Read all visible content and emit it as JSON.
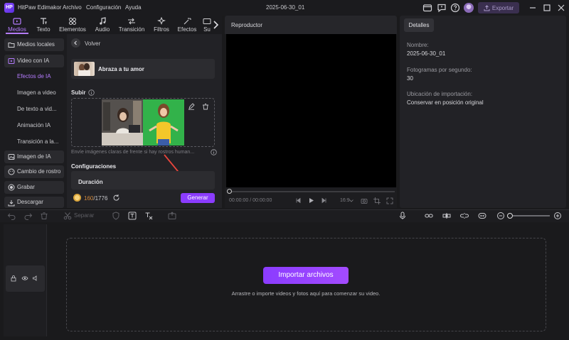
{
  "app": {
    "name": "HitPaw Edimakor",
    "logo_text": "HP",
    "project": "2025-06-30_01"
  },
  "menu": [
    "Archivo",
    "Configuración",
    "Ayuda"
  ],
  "titlebar": {
    "export_label": "Exportar"
  },
  "tool_tabs": [
    "Medios",
    "Texto",
    "Elementos",
    "Audio",
    "Transición",
    "Filtros",
    "Efectos",
    "Su"
  ],
  "nav": {
    "local_media": "Medios locales",
    "ai_video": "Video con IA",
    "sub": [
      "Efectos de IA",
      "Imagen a video",
      "De texto a vid...",
      "Animación IA",
      "Transición a la..."
    ],
    "ai_image": "Imagen de IA",
    "face_swap": "Cambio de rostro",
    "record": "Grabar",
    "download": "Descargar"
  },
  "panel": {
    "back": "Volver",
    "effect_name": "Abraza a tu amor",
    "upload_label": "Subir",
    "upload_hint": "Envíe imágenes claras de frente si hay rostros human...",
    "config_label": "Configuraciones",
    "duration_label": "Duración",
    "credits_used": "160",
    "credits_sep": "/",
    "credits_total": "1776",
    "generate": "Generar"
  },
  "player": {
    "title": "Reproductor",
    "time": "00:00:00 / 00:00:00",
    "ratio": "16:9",
    "progress": 0
  },
  "details": {
    "tab": "Detalles",
    "name_label": "Nombre:",
    "name_value": "2025-06-30_01",
    "fps_label": "Fotogramas por segundo:",
    "fps_value": "30",
    "import_label": "Ubicación de importación:",
    "import_value": "Conservar en posición original"
  },
  "timeline": {
    "split": "Separar",
    "import_button": "Importar archivos",
    "import_hint": "Arrastre o importe videos y fotos aquí para comenzar su video.",
    "zoom": 0
  },
  "colors": {
    "accent": "#b57cff",
    "button": "#8b3cff",
    "green_screen": "#32b24a"
  }
}
